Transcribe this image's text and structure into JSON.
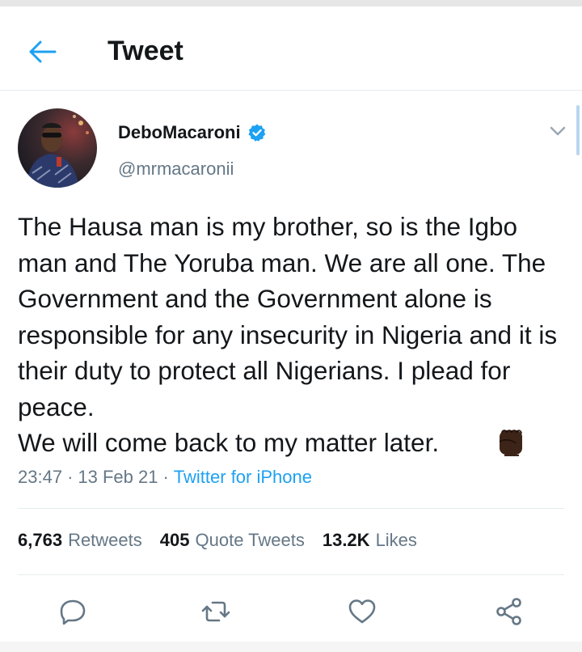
{
  "header": {
    "title": "Tweet",
    "back_icon": "arrow-left-icon"
  },
  "tweet": {
    "author_name": "DeboMacaroni",
    "handle": "@mrmacaronii",
    "verified": true,
    "text": "The Hausa man is my brother, so is the Igbo man and The Yoruba man. We are all one. The Government and the Government alone is responsible for any insecurity in Nigeria and it is their duty to protect all Nigerians. I plead for peace.\nWe will come back to my matter later.",
    "emoji": "raised-fist-dark",
    "time": "23:47",
    "date": "13 Feb 21",
    "separator": "·",
    "source": "Twitter for iPhone"
  },
  "stats": {
    "retweets_count": "6,763",
    "retweets_label": "Retweets",
    "quotes_count": "405",
    "quotes_label": "Quote Tweets",
    "likes_count": "13.2K",
    "likes_label": "Likes"
  },
  "actions": [
    "reply-icon",
    "retweet-icon",
    "like-icon",
    "share-icon"
  ],
  "colors": {
    "accent": "#1da1f2",
    "secondary_text": "#657786",
    "primary_text": "#14171a",
    "divider": "#e6ecf0"
  }
}
